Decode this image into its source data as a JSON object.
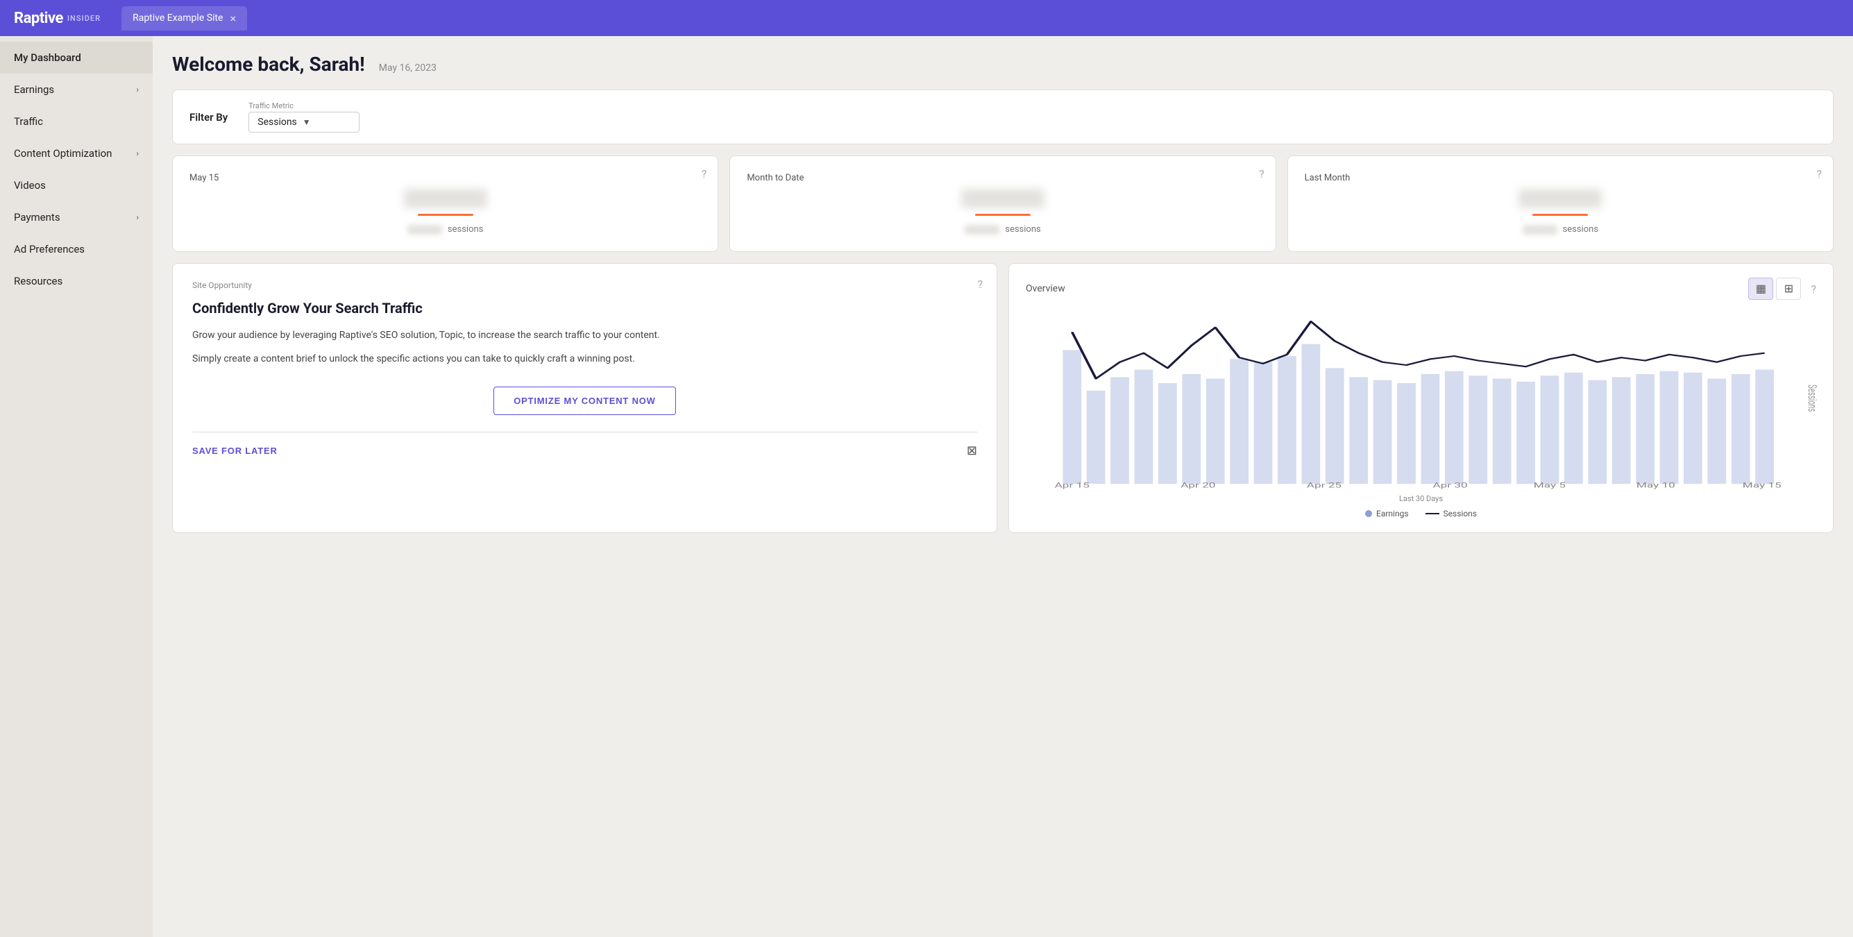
{
  "topbar": {
    "logo_text": "Raptive",
    "logo_badge": "INSIDER",
    "tab_title": "Raptive Example Site",
    "tab_close": "×"
  },
  "sidebar": {
    "items": [
      {
        "label": "My Dashboard",
        "active": true,
        "has_arrow": false
      },
      {
        "label": "Earnings",
        "active": false,
        "has_arrow": true
      },
      {
        "label": "Traffic",
        "active": false,
        "has_arrow": false
      },
      {
        "label": "Content Optimization",
        "active": false,
        "has_arrow": true
      },
      {
        "label": "Videos",
        "active": false,
        "has_arrow": false
      },
      {
        "label": "Payments",
        "active": false,
        "has_arrow": true
      },
      {
        "label": "Ad Preferences",
        "active": false,
        "has_arrow": false
      },
      {
        "label": "Resources",
        "active": false,
        "has_arrow": false
      }
    ]
  },
  "header": {
    "welcome": "Welcome back, Sarah!",
    "date": "May 16, 2023"
  },
  "filter": {
    "label": "Filter By",
    "metric_label": "Traffic Metric",
    "selected": "Sessions"
  },
  "stats": [
    {
      "title": "May 15",
      "sessions_label": "sessions"
    },
    {
      "title": "Month to Date",
      "sessions_label": "sessions"
    },
    {
      "title": "Last Month",
      "sessions_label": "sessions"
    }
  ],
  "opportunity": {
    "section_label": "Site Opportunity",
    "title": "Confidently Grow Your Search Traffic",
    "desc1": "Grow your audience by leveraging Raptive's SEO solution, Topic, to increase the search traffic to your content.",
    "desc2": "Simply create a content brief to unlock the specific actions you can take to quickly craft a winning post.",
    "btn_label": "OPTIMIZE MY CONTENT NOW",
    "save_label": "SAVE FOR LATER"
  },
  "overview": {
    "title": "Overview",
    "x_label": "Last 30 Days",
    "legend": {
      "earnings": "Earnings",
      "sessions": "Sessions"
    },
    "x_ticks": [
      "Apr 15",
      "Apr 20",
      "Apr 25",
      "Apr 30",
      "May 5",
      "May 10",
      "May 15"
    ],
    "bar_data": [
      85,
      60,
      70,
      75,
      65,
      72,
      68,
      80,
      78,
      82,
      90,
      75,
      70,
      68,
      65,
      72,
      74,
      70,
      68,
      66,
      70,
      72,
      65,
      68,
      70,
      72,
      74,
      68,
      72,
      75
    ],
    "line_data": [
      95,
      55,
      80,
      88,
      70,
      92,
      105,
      85,
      78,
      82,
      110,
      95,
      85,
      72,
      68,
      75,
      78,
      72,
      70,
      68,
      74,
      78,
      70,
      72,
      76,
      80,
      78,
      70,
      78,
      82
    ]
  },
  "icons": {
    "help_circle": "?",
    "chevron_right": "›",
    "chart_bar": "▦",
    "chart_table": "⊞",
    "dismiss": "⊠"
  }
}
